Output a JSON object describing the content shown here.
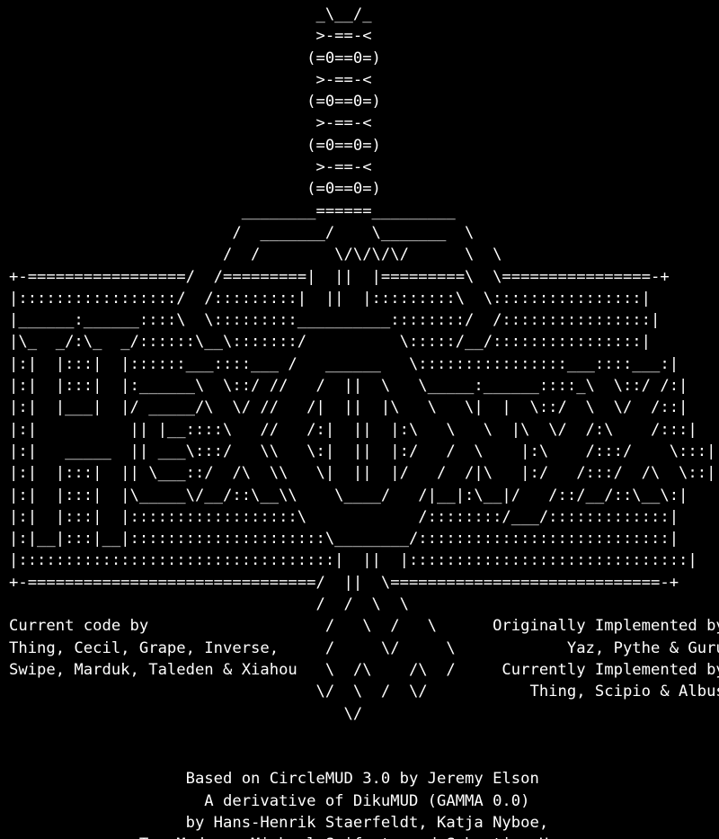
{
  "terminal": {
    "colors": {
      "background": "#000000",
      "foreground": "#ffffff"
    },
    "art_lines": [
      "                                 _\\__/_",
      "                                 >-==-<",
      "                                (=0==0=)",
      "                                 >-==-<",
      "                                (=0==0=)",
      "                                 >-==-<",
      "                                (=0==0=)",
      "                                 >-==-<",
      "                                (=0==0=)",
      "                         ________======_________",
      "                        /  _______/    \\_______  \\",
      "                       /  /        \\/\\/\\/\\/      \\  \\",
      "+-=================/  /=========|  ||  |=========\\  \\================-+",
      "|:::::::::::::::::/  /:::::::::|  ||  |:::::::::\\  \\::::::::::::::::|",
      "|______:______::::\\  \\:::::::::__________::::::::/  /::::::::::::::::|",
      "|\\_  _/:\\_  _/::::::\\__\\:::::::/          \\:::::/__/::::::::::::::::|",
      "|:|  |:::|  |::::::___::::___ /   ______   \\::::::::::::::::___::::___:|",
      "|:|  |:::|  |:______\\  \\::/ //   /  ||  \\   \\_____:______::::_\\  \\::/ /:|",
      "|:|  |___|  |/ _____/\\  \\/ //   /|  ||  |\\   \\   \\|  |  \\::/  \\  \\/  /::|",
      "|:|          || |__::::\\   //   /:|  ||  |:\\   \\   \\  |\\  \\/  /:\\    /:::|",
      "|:|   _____  || ___\\:::/   \\\\   \\:|  ||  |:/   /  \\    |:\\    /:::/    \\:::|",
      "|:|  |:::|  || \\___::/  /\\  \\\\   \\|  ||  |/   /  /|\\   |:/   /:::/  /\\  \\::|",
      "|:|  |:::|  |\\_____\\/__/::\\__\\\\    \\____/   /|__|:\\__|/   /::/__/::\\__\\:|",
      "|:|  |:::|  |::::::::::::::::::\\            /::::::::/___/:::::::::::::|",
      "|:|__|:::|__|:::::::::::::::::::::\\________/:::::::::::::::::::::::::::|",
      "|::::::::::::::::::::::::::::::::::|  ||  |::::::::::::::::::::::::::::::|",
      "+-===============================/  ||  \\=============================-+",
      "                                 /  /  \\  \\"
    ],
    "credits": [
      {
        "left": "Current code by",
        "art": "                       /   \\  /   \\",
        "right": "Originally Implemented by"
      },
      {
        "left": "Thing, Cecil, Grape, Inverse,",
        "art": "   /     \\/     \\",
        "right": "Yaz, Pythe & Guru"
      },
      {
        "left": "Swipe, Marduk, Taleden & Xiahou",
        "art": " \\  /\\    /\\  /",
        "right": "Currently Implemented by"
      },
      {
        "left": "",
        "art": "                                 \\/  \\  /  \\/",
        "right": "Thing, Scipio & Albus"
      }
    ],
    "art_tail": "                                    \\/",
    "based_on": [
      "Based on CircleMUD 3.0 by Jeremy Elson",
      "A derivative of DikuMUD (GAMMA 0.0)",
      "by Hans-Henrik Staerfeldt, Katja Nyboe,",
      "Tom Madsen, Michael Seifert, and Sebastian Hammer"
    ]
  }
}
